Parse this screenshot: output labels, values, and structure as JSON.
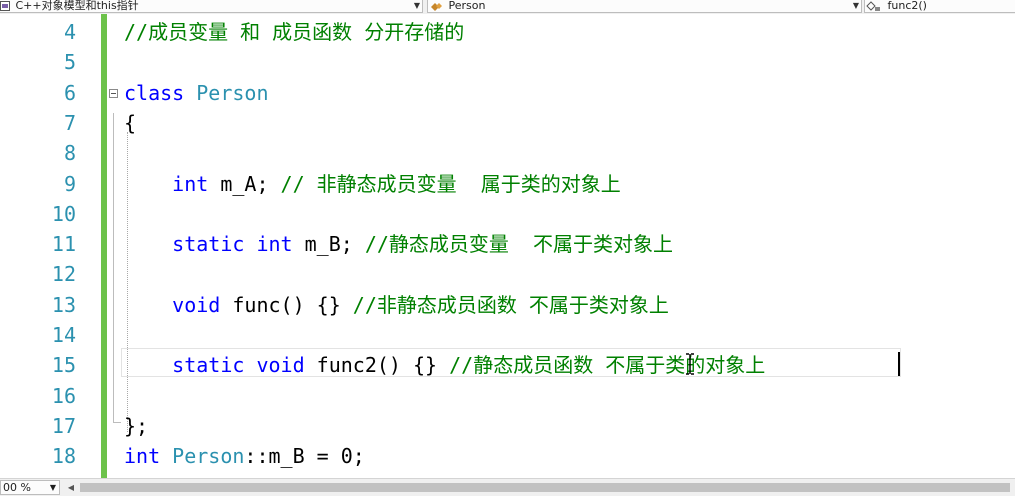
{
  "navbar": {
    "file_combo": "C++对象模型和this指针",
    "class_combo": "Person",
    "member_combo": "func2()"
  },
  "editor": {
    "lines": [
      {
        "num": "4",
        "parts": [
          [
            "cm",
            "//成员变量 和 成员函数 分开存储的"
          ]
        ]
      },
      {
        "num": "5",
        "parts": []
      },
      {
        "num": "6",
        "parts": [
          [
            "kw",
            "class"
          ],
          [
            "",
            " "
          ],
          [
            "ty",
            "Person"
          ]
        ]
      },
      {
        "num": "7",
        "parts": [
          [
            "",
            "{"
          ]
        ]
      },
      {
        "num": "8",
        "parts": []
      },
      {
        "num": "9",
        "parts": [
          [
            "",
            "    "
          ],
          [
            "kw",
            "int"
          ],
          [
            "",
            " m_A; "
          ],
          [
            "cm",
            "// 非静态成员变量  属于类的对象上"
          ]
        ]
      },
      {
        "num": "10",
        "parts": []
      },
      {
        "num": "11",
        "parts": [
          [
            "",
            "    "
          ],
          [
            "kw",
            "static"
          ],
          [
            "",
            " "
          ],
          [
            "kw",
            "int"
          ],
          [
            "",
            " m_B; "
          ],
          [
            "cm",
            "//静态成员变量  不属于类对象上"
          ]
        ]
      },
      {
        "num": "12",
        "parts": []
      },
      {
        "num": "13",
        "parts": [
          [
            "",
            "    "
          ],
          [
            "kw",
            "void"
          ],
          [
            "",
            " func() {} "
          ],
          [
            "cm",
            "//非静态成员函数 不属于类对象上"
          ]
        ]
      },
      {
        "num": "14",
        "parts": []
      },
      {
        "num": "15",
        "parts": [
          [
            "",
            "    "
          ],
          [
            "kw",
            "static"
          ],
          [
            "",
            " "
          ],
          [
            "kw",
            "void"
          ],
          [
            "",
            " func2() {} "
          ],
          [
            "cm",
            "//静态成员函数 不属于类的对象上"
          ]
        ]
      },
      {
        "num": "16",
        "parts": []
      },
      {
        "num": "17",
        "parts": [
          [
            "",
            "};"
          ]
        ]
      },
      {
        "num": "18",
        "parts": [
          [
            "kw",
            "int"
          ],
          [
            "",
            " "
          ],
          [
            "ty",
            "Person"
          ],
          [
            "",
            "::m_B = 0;"
          ]
        ]
      }
    ]
  },
  "status": {
    "zoom": "00 %"
  },
  "colors": {
    "keyword": "#0000ff",
    "type": "#2b91af",
    "comment": "#008000",
    "line_number": "#2b91af",
    "change_bar": "#6cc24a"
  },
  "icons": {
    "file": "cpp-file-icon",
    "class": "class-icon",
    "member": "method-icon",
    "dropdown": "chevron-down-icon",
    "collapse": "collapse-minus-icon"
  }
}
